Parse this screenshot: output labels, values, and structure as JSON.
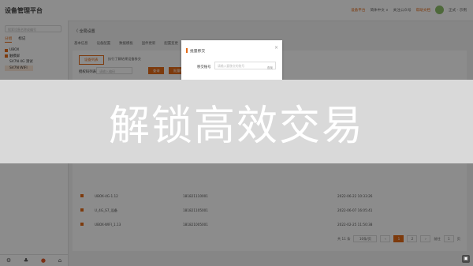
{
  "app": {
    "title": "设备管理平台"
  },
  "topbar": {
    "link_console": "设备平台",
    "link_lang": "简体中文 ∨",
    "link_help": "关注公众号",
    "link_doc": "帮助文档",
    "user": "正式 - 示例"
  },
  "sidebar": {
    "search_placeholder": "搜索设备名称或编号",
    "tabs": [
      "分组",
      "标记"
    ],
    "tree": [
      {
        "label": "UBOX"
      },
      {
        "label": "触摸屏"
      },
      {
        "label": "SV7N 4G 测试"
      },
      {
        "label": "SV7N WIFI"
      }
    ],
    "footer_icons": [
      "settings-icon",
      "org-icon",
      "record-icon",
      "home-icon"
    ]
  },
  "main": {
    "breadcrumb": "〈 全局设置",
    "tabs": [
      "基本信息",
      "设备配置",
      "数据模板",
      "固件更新",
      "配置变更"
    ],
    "subtabs": [
      "设备列表",
      "执行了解结果设备移交"
    ],
    "filter_label": "授权码列表",
    "filter_placeholder": "请输入编码",
    "buttons": [
      "查询",
      "批量移交"
    ]
  },
  "table": {
    "rows": [
      {
        "name": "UBOX-4G-1.12",
        "code": "181821110001",
        "date": "2022-06-22 10:33:26"
      },
      {
        "name": "U_4G_S7_设备",
        "code": "181821105001",
        "date": "2022-06-07 16:05:41"
      },
      {
        "name": "UBOX-WIFI_1.13",
        "code": "181821005001",
        "date": "2022-02-25 11:50:38"
      }
    ]
  },
  "pager": {
    "total": "共 11 条",
    "page_size": "10条/页",
    "prev": "‹",
    "pages": [
      "1",
      "2"
    ],
    "next": "›",
    "goto_label": "前往",
    "goto_value": "1",
    "page_suffix": "页"
  },
  "modal": {
    "title": "批量移交",
    "close": "×",
    "label": "移交账号",
    "placeholder": "请输入要移交的账号",
    "check_button": "查找"
  },
  "banner": {
    "text": "解锁高效交易"
  },
  "colors": {
    "accent": "#e46a17"
  }
}
